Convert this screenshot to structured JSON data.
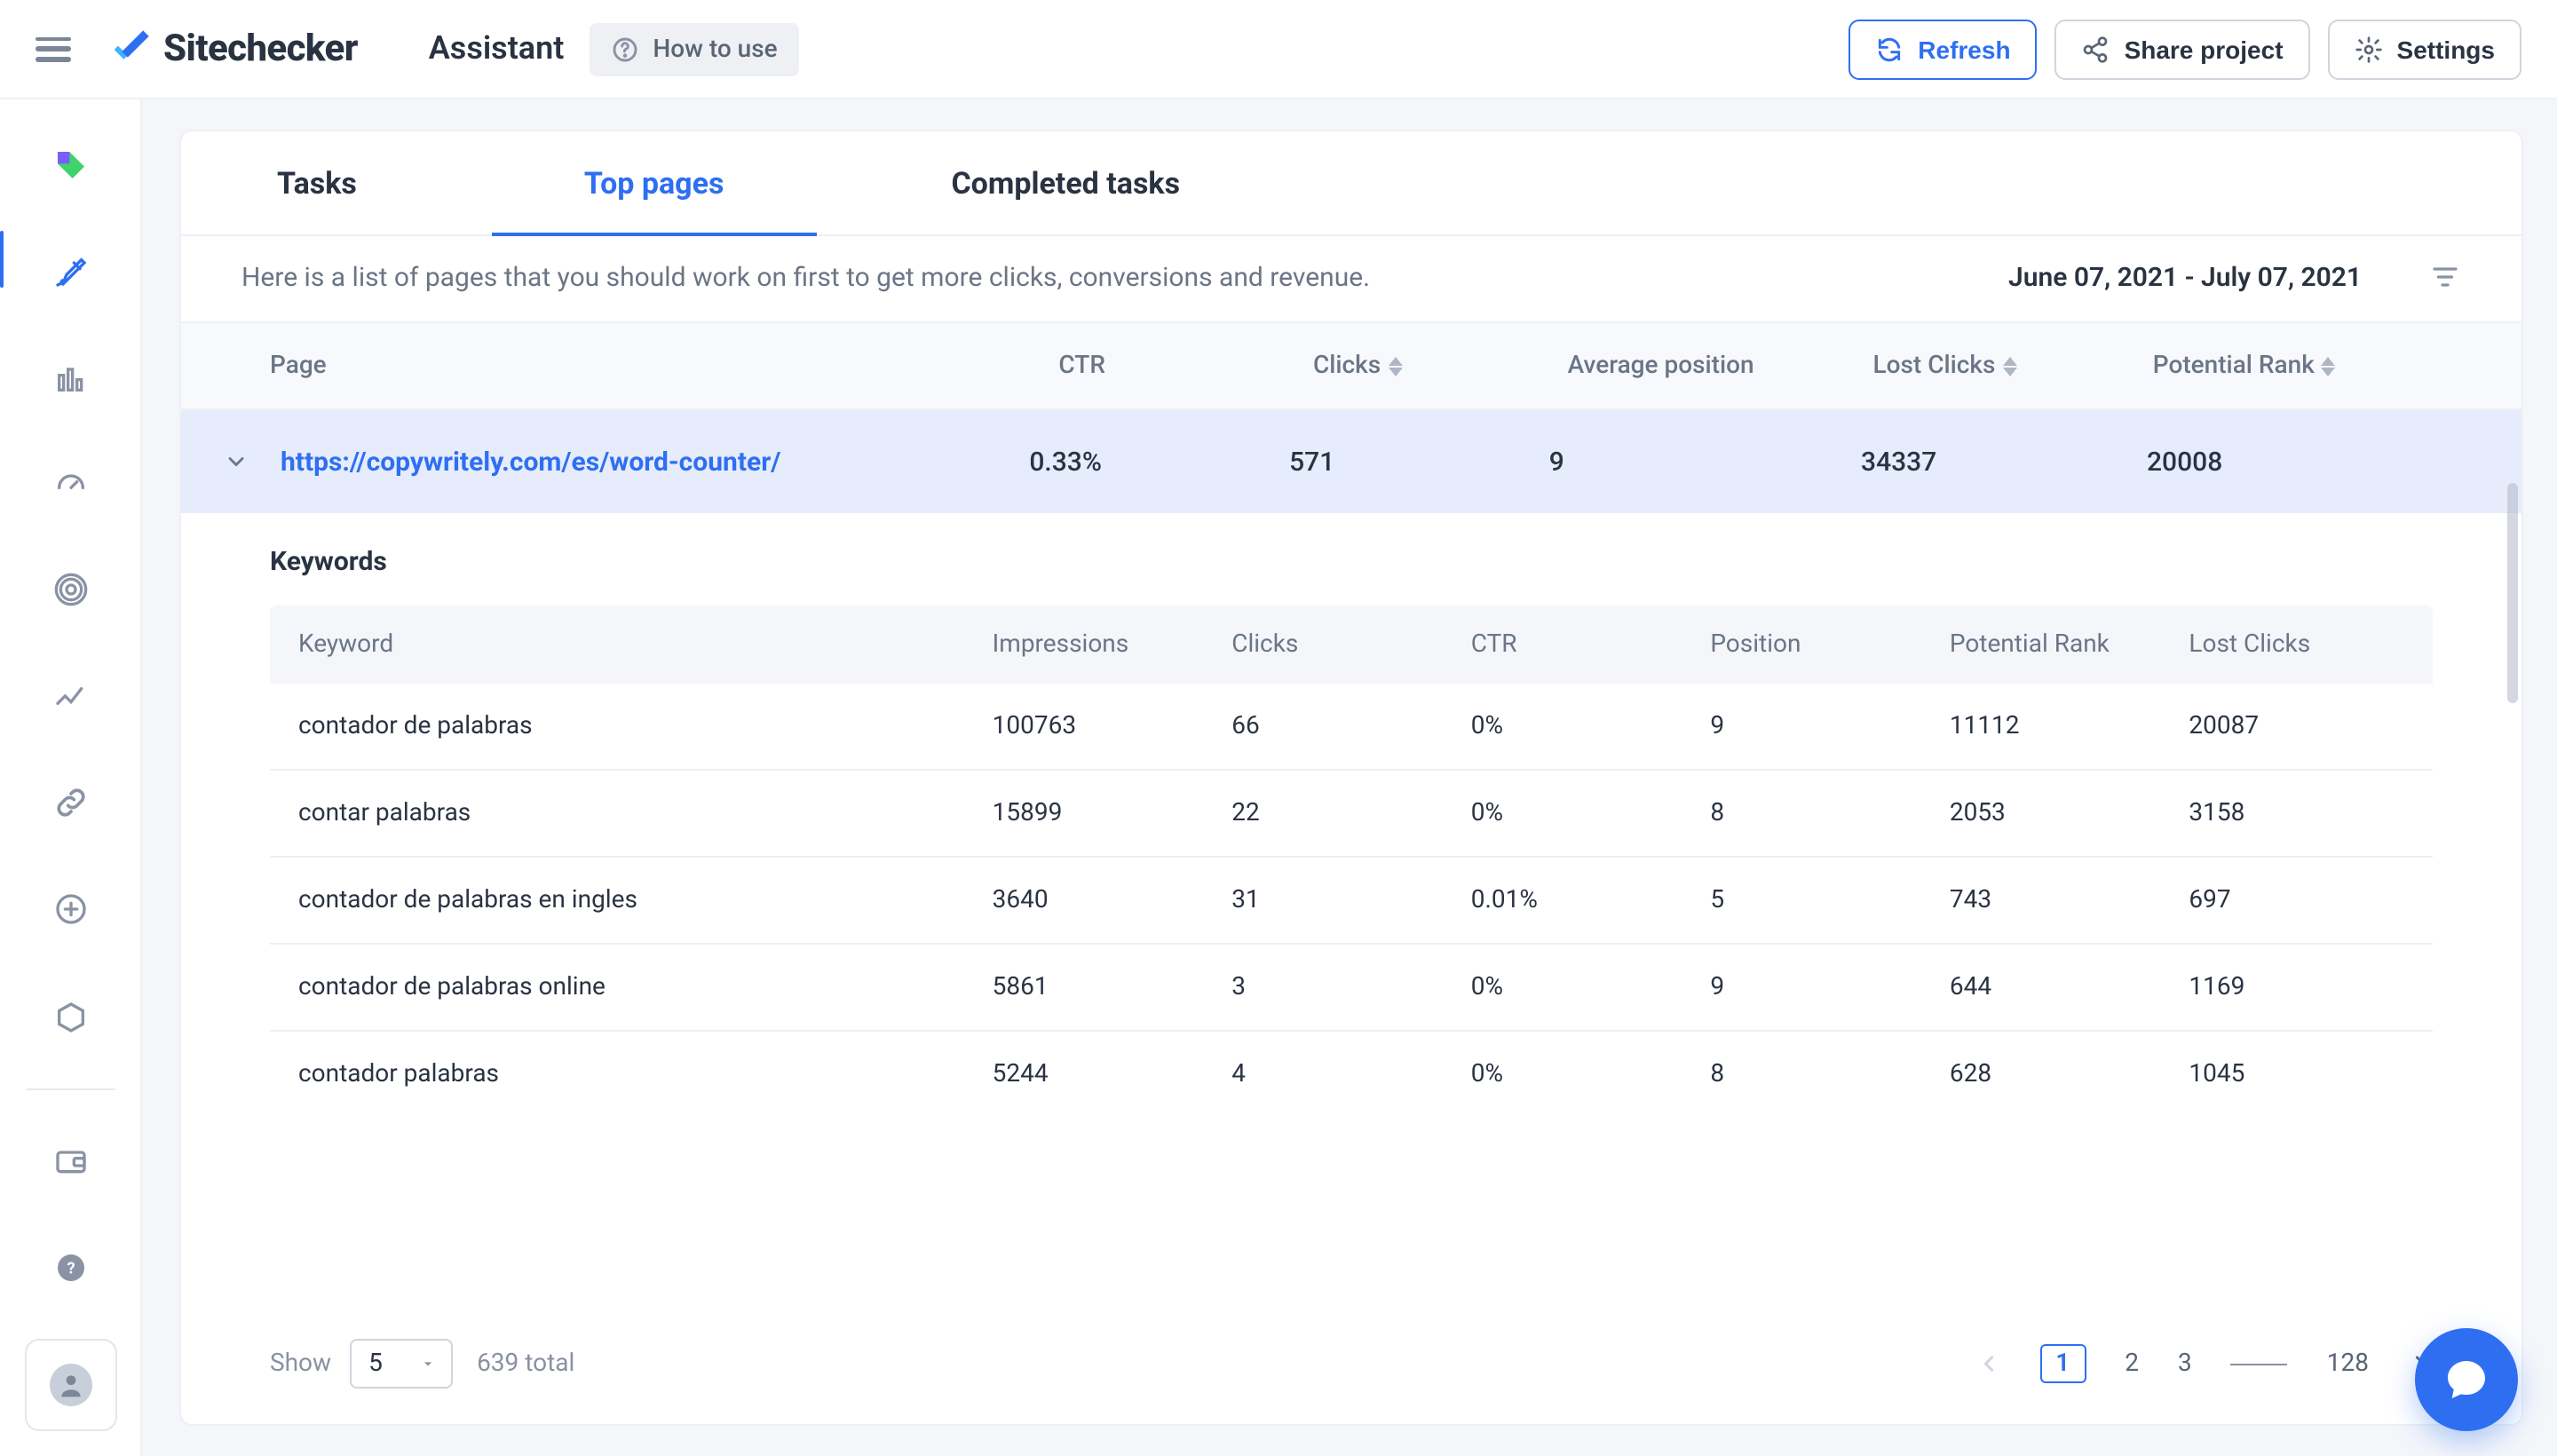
{
  "header": {
    "brand": "Sitechecker",
    "page_title": "Assistant",
    "how_to": "How to use",
    "refresh": "Refresh",
    "share": "Share project",
    "settings": "Settings"
  },
  "tabs": {
    "tasks": "Tasks",
    "top_pages": "Top pages",
    "completed": "Completed tasks",
    "active_index": 1
  },
  "description": "Here is a list of pages that you should work on first to get more clicks, conversions and revenue.",
  "date_range": "June 07, 2021 - July 07, 2021",
  "main_columns": {
    "page": "Page",
    "ctr": "CTR",
    "clicks": "Clicks",
    "avg_pos": "Average position",
    "lost_clicks": "Lost Clicks",
    "potential_rank": "Potential Rank"
  },
  "expanded": {
    "url": "https://copywritely.com/es/word-counter/",
    "ctr": "0.33%",
    "clicks": "571",
    "avg_pos": "9",
    "lost_clicks": "34337",
    "potential_rank": "20008"
  },
  "keywords_section": {
    "title": "Keywords",
    "columns": {
      "keyword": "Keyword",
      "impressions": "Impressions",
      "clicks": "Clicks",
      "ctr": "CTR",
      "position": "Position",
      "potential_rank": "Potential Rank",
      "lost_clicks": "Lost Clicks"
    },
    "rows": [
      {
        "keyword": "contador de palabras",
        "impressions": "100763",
        "clicks": "66",
        "ctr": "0%",
        "position": "9",
        "potential_rank": "11112",
        "lost_clicks": "20087"
      },
      {
        "keyword": "contar palabras",
        "impressions": "15899",
        "clicks": "22",
        "ctr": "0%",
        "position": "8",
        "potential_rank": "2053",
        "lost_clicks": "3158"
      },
      {
        "keyword": "contador de palabras en ingles",
        "impressions": "3640",
        "clicks": "31",
        "ctr": "0.01%",
        "position": "5",
        "potential_rank": "743",
        "lost_clicks": "697"
      },
      {
        "keyword": "contador de palabras online",
        "impressions": "5861",
        "clicks": "3",
        "ctr": "0%",
        "position": "9",
        "potential_rank": "644",
        "lost_clicks": "1169"
      },
      {
        "keyword": "contador palabras",
        "impressions": "5244",
        "clicks": "4",
        "ctr": "0%",
        "position": "8",
        "potential_rank": "628",
        "lost_clicks": "1045"
      }
    ]
  },
  "footer": {
    "show_label": "Show",
    "page_size": "5",
    "total": "639 total",
    "pages": [
      "1",
      "2",
      "3",
      "128"
    ],
    "current_page_index": 0
  }
}
